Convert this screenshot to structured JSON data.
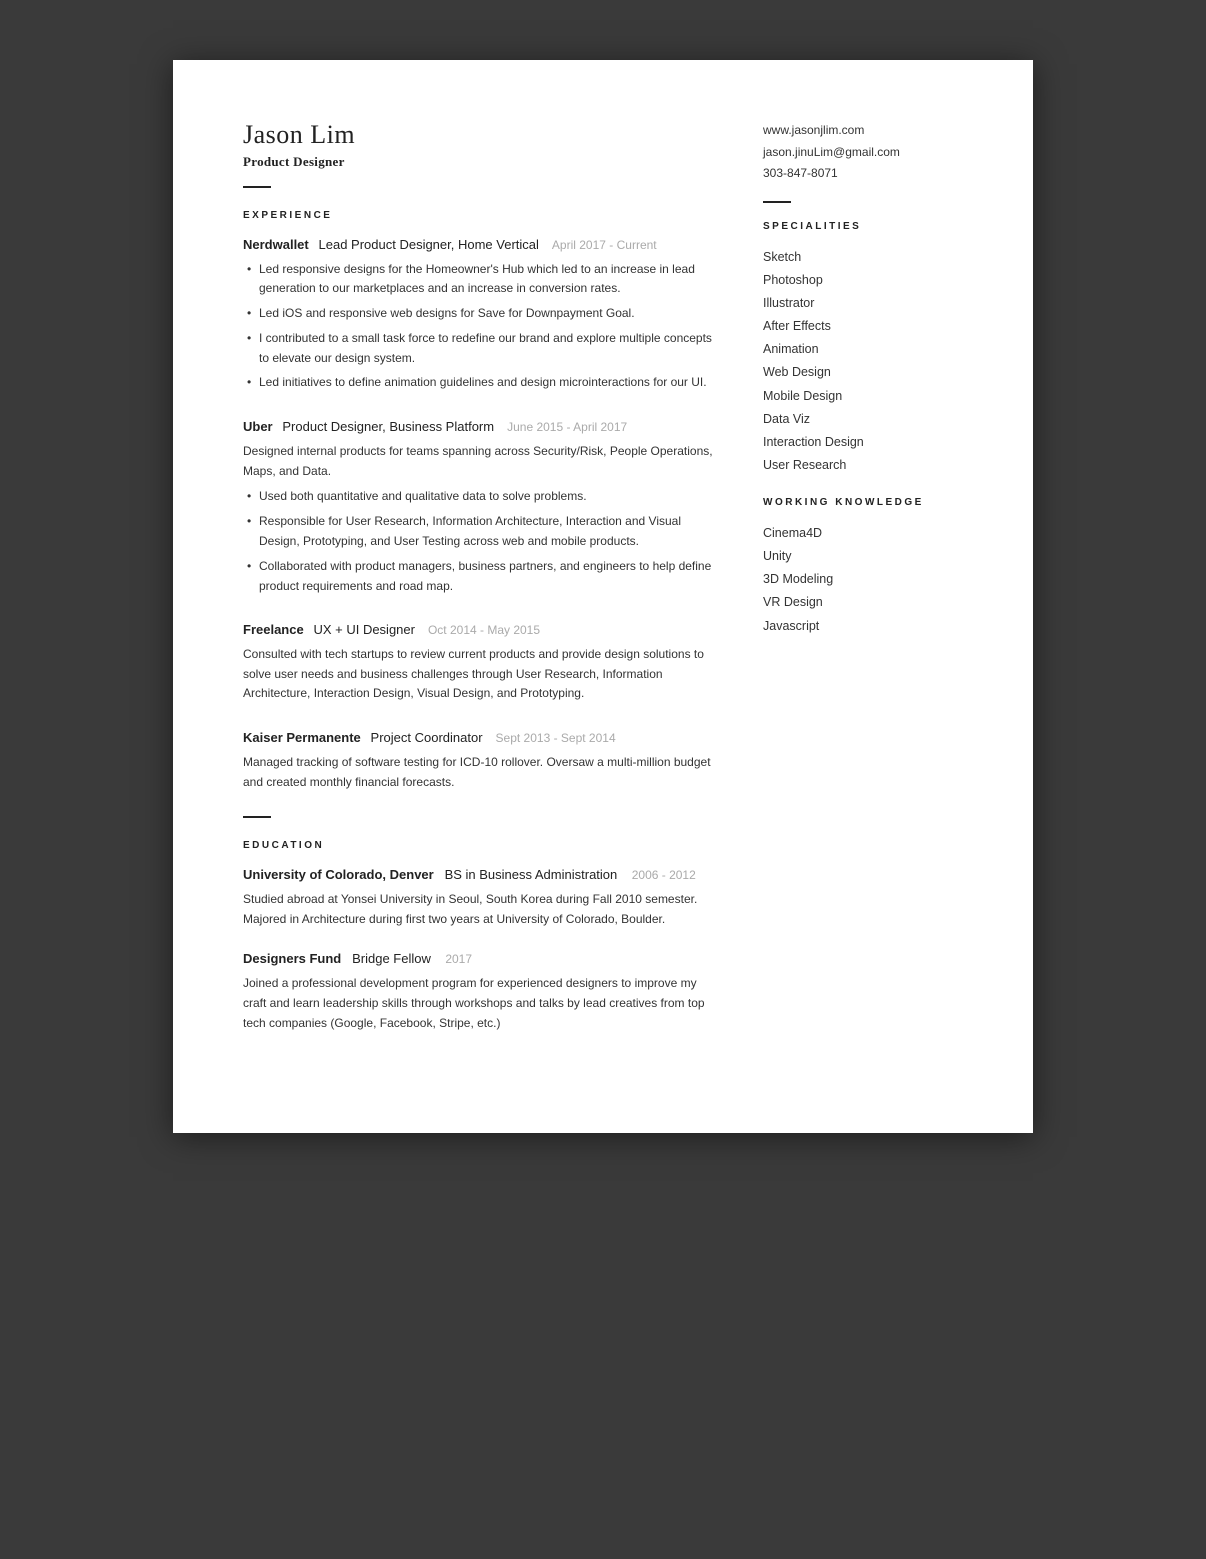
{
  "header": {
    "name": "Jason Lim",
    "title": "Product Designer"
  },
  "contact": {
    "website": "www.jasonjlim.com",
    "email": "jason.jinuLim@gmail.com",
    "phone": "303-847-8071"
  },
  "sections": {
    "experience_label": "EXPERIENCE",
    "education_label": "EDUCATION",
    "specialities_label": "SPECIALITIES",
    "working_knowledge_label": "WORKING  KNOWLEDGE"
  },
  "experience": [
    {
      "company": "Nerdwallet",
      "role": "Lead Product Designer, Home Vertical",
      "dates": "April 2017 - Current",
      "bullets": [
        "Led responsive designs for the Homeowner's Hub which led to an increase in lead generation to our marketplaces and an increase in conversion rates.",
        "Led iOS and responsive web designs for Save for Downpayment Goal.",
        "I contributed to a small task force to redefine our brand and explore multiple concepts to elevate our design system.",
        "Led initiatives to define animation guidelines and design microinteractions for our UI."
      ]
    },
    {
      "company": "Uber",
      "role": "Product Designer, Business Platform",
      "dates": "June 2015 - April 2017",
      "desc": "Designed internal products for teams spanning across Security/Risk, People Operations, Maps, and Data.",
      "bullets": [
        "Used both quantitative and qualitative data to solve problems.",
        "Responsible for User Research, Information Architecture, Interaction and Visual Design, Prototyping, and User Testing across web and mobile products.",
        "Collaborated with product managers, business partners, and engineers to help define product requirements and road map."
      ]
    },
    {
      "company": "Freelance",
      "role": "UX + UI Designer",
      "dates": "Oct 2014 - May 2015",
      "desc": "Consulted with tech startups to review current products and provide design solutions to solve user needs and business challenges through User Research, Information Architecture, Interaction Design, Visual Design, and Prototyping.",
      "bullets": []
    },
    {
      "company": "Kaiser Permanente",
      "role": "Project Coordinator",
      "dates": "Sept 2013 - Sept 2014",
      "desc": "Managed tracking of software testing for ICD-10 rollover. Oversaw a multi-million budget and created monthly financial forecasts.",
      "bullets": []
    }
  ],
  "education": [
    {
      "institution": "University of Colorado, Denver",
      "degree": "BS in Business Administration",
      "dates": "2006 - 2012",
      "desc": "Studied abroad at Yonsei University in Seoul, South Korea during Fall 2010 semester. Majored in Architecture during first two years at University of Colorado, Boulder."
    },
    {
      "institution": "Designers Fund",
      "degree": "Bridge Fellow",
      "dates": "2017",
      "desc": "Joined a professional development program for experienced designers to improve my craft and learn leadership skills through workshops and talks by lead creatives from top tech companies (Google, Facebook, Stripe, etc.)"
    }
  ],
  "specialities": [
    "Sketch",
    "Photoshop",
    "Illustrator",
    "After Effects",
    "Animation",
    "Web Design",
    "Mobile Design",
    "Data Viz",
    "Interaction Design",
    "User Research"
  ],
  "working_knowledge": [
    "Cinema4D",
    "Unity",
    "3D Modeling",
    "VR Design",
    "Javascript"
  ]
}
